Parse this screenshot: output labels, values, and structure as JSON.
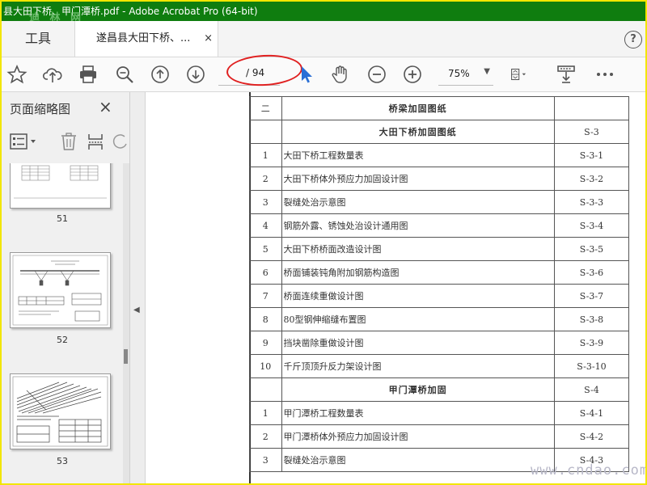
{
  "window": {
    "title": "县大田下桥、甲门潭桥.pdf - Adobe Acrobat Pro (64-bit)",
    "watermark": "迪 林 网"
  },
  "tabs": {
    "tools": "工具",
    "document": "遂昌县大田下桥、...",
    "close": "×",
    "help": "?"
  },
  "toolbar": {
    "page_total": "/ 94",
    "zoom": "75%",
    "icons": [
      "star-icon",
      "cloud-upload-icon",
      "printer-icon",
      "zoom-out-magnifier-icon",
      "page-up-icon",
      "page-down-icon",
      "select-cursor-icon",
      "hand-tool-icon",
      "zoom-out-icon",
      "zoom-in-icon",
      "fit-page-icon",
      "comment-stamp-icon",
      "more-icon"
    ]
  },
  "thumbnails_panel": {
    "title": "页面缩略图",
    "close": "×",
    "pages": [
      {
        "label": "51"
      },
      {
        "label": "52"
      },
      {
        "label": "53"
      }
    ]
  },
  "document": {
    "rows": [
      {
        "type": "header",
        "n": "二",
        "name": "桥梁加固图纸",
        "code": ""
      },
      {
        "type": "header",
        "n": "",
        "name": "大田下桥加固图纸",
        "code": "S-3"
      },
      {
        "type": "item",
        "n": "1",
        "name": "大田下桥工程数量表",
        "code": "S-3-1"
      },
      {
        "type": "item",
        "n": "2",
        "name": "大田下桥体外预应力加固设计图",
        "code": "S-3-2"
      },
      {
        "type": "item",
        "n": "3",
        "name": "裂缝处治示意图",
        "code": "S-3-3"
      },
      {
        "type": "item",
        "n": "4",
        "name": "钢筋外露、锈蚀处治设计通用图",
        "code": "S-3-4"
      },
      {
        "type": "item",
        "n": "5",
        "name": "大田下桥桥面改造设计图",
        "code": "S-3-5"
      },
      {
        "type": "item",
        "n": "6",
        "name": "桥面铺装钝角附加钢筋构造图",
        "code": "S-3-6"
      },
      {
        "type": "item",
        "n": "7",
        "name": "桥面连续重做设计图",
        "code": "S-3-7"
      },
      {
        "type": "item",
        "n": "8",
        "name": "80型钢伸缩缝布置图",
        "code": "S-3-8"
      },
      {
        "type": "item",
        "n": "9",
        "name": "挡块凿除重做设计图",
        "code": "S-3-9"
      },
      {
        "type": "item",
        "n": "10",
        "name": "千斤顶顶升反力架设计图",
        "code": "S-3-10"
      },
      {
        "type": "header",
        "n": "",
        "name": "甲门潭桥加固",
        "code": "S-4"
      },
      {
        "type": "item",
        "n": "1",
        "name": "甲门潭桥工程数量表",
        "code": "S-4-1"
      },
      {
        "type": "item",
        "n": "2",
        "name": "甲门潭桥体外预应力加固设计图",
        "code": "S-4-2"
      },
      {
        "type": "item",
        "n": "3",
        "name": "裂缝处治示意图",
        "code": "S-4-3"
      }
    ],
    "watermark": "www.cndao.com"
  }
}
